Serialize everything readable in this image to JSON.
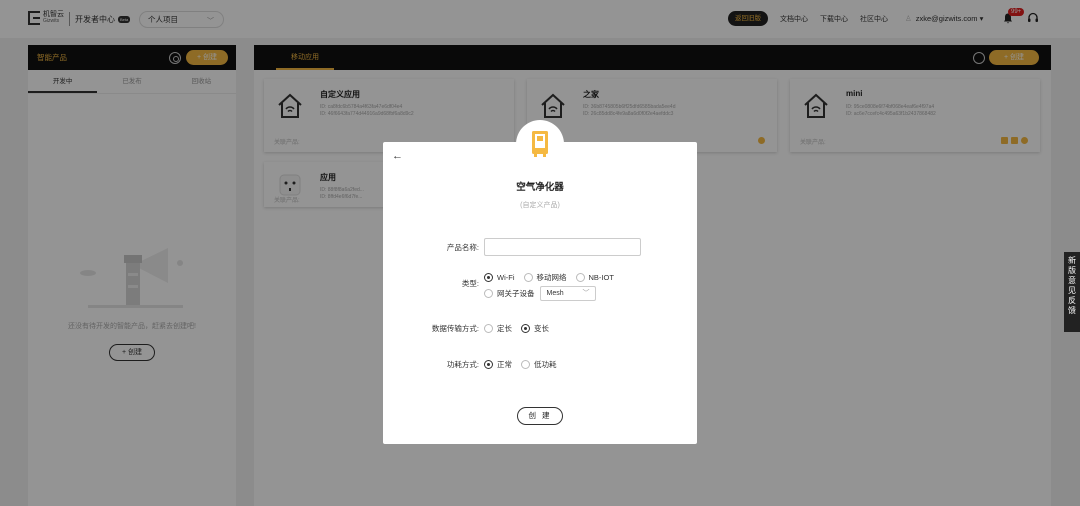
{
  "header": {
    "logo_cn": "机智云",
    "logo_en": "Gizwits",
    "dev_center": "开发者中心",
    "beta": "Beta",
    "project": "个人项目",
    "back_old": "返回旧版",
    "nav": [
      "文档中心",
      "下载中心",
      "社区中心"
    ],
    "user": "zxke@gizwits.com ▾",
    "notifications": "99+"
  },
  "left_panel": {
    "title": "智能产品",
    "create": "+ 创建",
    "tabs": [
      "开发中",
      "已发布",
      "回收站"
    ],
    "empty_text": "还没有待开发的智能产品，赶紧去创建吧!",
    "empty_create": "+ 创建"
  },
  "right_panel": {
    "tab": "移动应用",
    "create": "+ 创建",
    "cards": [
      {
        "name": "自定义应用",
        "id1": "ID: ca8fdc6b5784a4f63fa47e6df04e4",
        "id2": "ID: 46f6643fa774d44916a9d68fbf6a8d9c2",
        "foot": "关联产品:"
      },
      {
        "name": "之家",
        "id1": "ID: 36b8745805b6ff25dfd6585bada5ee4d",
        "id2": "ID: 26c85dd8c4fe9a8a6d0f0f2e4aefddc3",
        "foot": ""
      },
      {
        "name": "mini",
        "id1": "ID: 95ce0808e6f74bf068e4eaf6e4f97a4",
        "id2": "ID: ac6e7ccefc4c495a63f1b2437868482",
        "foot": "关联产品:"
      },
      {
        "name": "应用",
        "id1": "ID: 88f8f8a6a2fed...",
        "id2": "ID: 8ffd4e6f6d7fe...",
        "foot": "关联产品:"
      }
    ]
  },
  "modal": {
    "title": "空气净化器",
    "subtitle": "(自定义产品)",
    "name_label": "产品名称:",
    "name_value": "",
    "type_label": "类型:",
    "type_options": [
      "Wi-Fi",
      "移动网络",
      "NB-IOT",
      "网关子设备"
    ],
    "type_selected": "Wi-Fi",
    "mesh_value": "Mesh",
    "transfer_label": "数据传输方式:",
    "transfer_options": [
      "定长",
      "变长"
    ],
    "transfer_selected": "变长",
    "power_label": "功耗方式:",
    "power_options": [
      "正常",
      "低功耗"
    ],
    "power_selected": "正常",
    "create_button": "创 建"
  },
  "feedback": "新版意见反馈"
}
